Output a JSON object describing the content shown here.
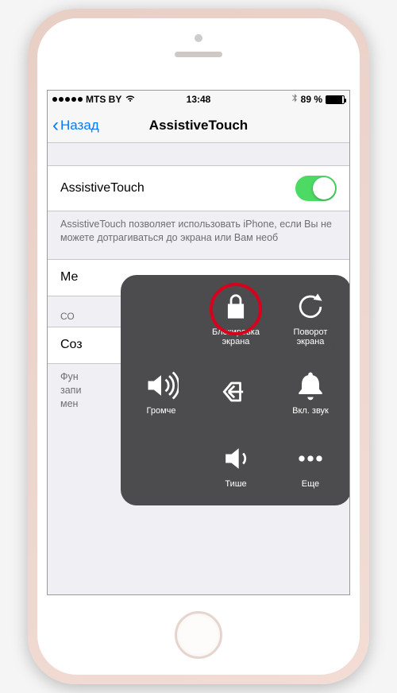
{
  "status": {
    "carrier": "MTS BY",
    "time": "13:48",
    "battery_pct": "89 %"
  },
  "nav": {
    "back": "Назад",
    "title": "AssistiveTouch"
  },
  "rows": {
    "toggle_label": "AssistiveTouch",
    "toggle_desc": "AssistiveTouch позволяет использовать iPhone, если Вы не можете дотрагиваться до экрана или Вам необ",
    "menu_row": "Ме",
    "section2": "СО",
    "create_row": "Соз",
    "footer2": "Фун\nзапи\nмен"
  },
  "at_menu": {
    "lock": "Блокировка\nэкрана",
    "rotate": "Поворот\nэкрана",
    "vol_up": "Громче",
    "vol_down": "Тише",
    "sound_on": "Вкл. звук",
    "more": "Еще"
  }
}
